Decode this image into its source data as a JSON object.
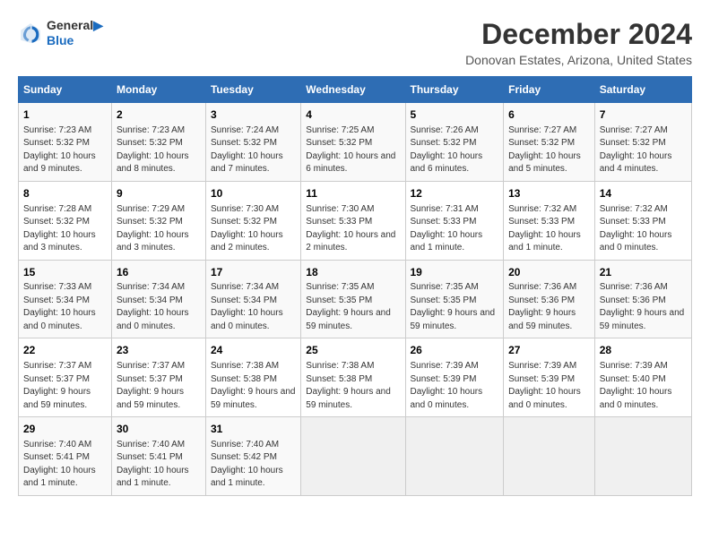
{
  "header": {
    "logo_line1": "General",
    "logo_line2": "Blue",
    "title": "December 2024",
    "subtitle": "Donovan Estates, Arizona, United States"
  },
  "columns": [
    "Sunday",
    "Monday",
    "Tuesday",
    "Wednesday",
    "Thursday",
    "Friday",
    "Saturday"
  ],
  "weeks": [
    [
      {
        "day": "1",
        "text": "Sunrise: 7:23 AM\nSunset: 5:32 PM\nDaylight: 10 hours and 9 minutes."
      },
      {
        "day": "2",
        "text": "Sunrise: 7:23 AM\nSunset: 5:32 PM\nDaylight: 10 hours and 8 minutes."
      },
      {
        "day": "3",
        "text": "Sunrise: 7:24 AM\nSunset: 5:32 PM\nDaylight: 10 hours and 7 minutes."
      },
      {
        "day": "4",
        "text": "Sunrise: 7:25 AM\nSunset: 5:32 PM\nDaylight: 10 hours and 6 minutes."
      },
      {
        "day": "5",
        "text": "Sunrise: 7:26 AM\nSunset: 5:32 PM\nDaylight: 10 hours and 6 minutes."
      },
      {
        "day": "6",
        "text": "Sunrise: 7:27 AM\nSunset: 5:32 PM\nDaylight: 10 hours and 5 minutes."
      },
      {
        "day": "7",
        "text": "Sunrise: 7:27 AM\nSunset: 5:32 PM\nDaylight: 10 hours and 4 minutes."
      }
    ],
    [
      {
        "day": "8",
        "text": "Sunrise: 7:28 AM\nSunset: 5:32 PM\nDaylight: 10 hours and 3 minutes."
      },
      {
        "day": "9",
        "text": "Sunrise: 7:29 AM\nSunset: 5:32 PM\nDaylight: 10 hours and 3 minutes."
      },
      {
        "day": "10",
        "text": "Sunrise: 7:30 AM\nSunset: 5:32 PM\nDaylight: 10 hours and 2 minutes."
      },
      {
        "day": "11",
        "text": "Sunrise: 7:30 AM\nSunset: 5:33 PM\nDaylight: 10 hours and 2 minutes."
      },
      {
        "day": "12",
        "text": "Sunrise: 7:31 AM\nSunset: 5:33 PM\nDaylight: 10 hours and 1 minute."
      },
      {
        "day": "13",
        "text": "Sunrise: 7:32 AM\nSunset: 5:33 PM\nDaylight: 10 hours and 1 minute."
      },
      {
        "day": "14",
        "text": "Sunrise: 7:32 AM\nSunset: 5:33 PM\nDaylight: 10 hours and 0 minutes."
      }
    ],
    [
      {
        "day": "15",
        "text": "Sunrise: 7:33 AM\nSunset: 5:34 PM\nDaylight: 10 hours and 0 minutes."
      },
      {
        "day": "16",
        "text": "Sunrise: 7:34 AM\nSunset: 5:34 PM\nDaylight: 10 hours and 0 minutes."
      },
      {
        "day": "17",
        "text": "Sunrise: 7:34 AM\nSunset: 5:34 PM\nDaylight: 10 hours and 0 minutes."
      },
      {
        "day": "18",
        "text": "Sunrise: 7:35 AM\nSunset: 5:35 PM\nDaylight: 9 hours and 59 minutes."
      },
      {
        "day": "19",
        "text": "Sunrise: 7:35 AM\nSunset: 5:35 PM\nDaylight: 9 hours and 59 minutes."
      },
      {
        "day": "20",
        "text": "Sunrise: 7:36 AM\nSunset: 5:36 PM\nDaylight: 9 hours and 59 minutes."
      },
      {
        "day": "21",
        "text": "Sunrise: 7:36 AM\nSunset: 5:36 PM\nDaylight: 9 hours and 59 minutes."
      }
    ],
    [
      {
        "day": "22",
        "text": "Sunrise: 7:37 AM\nSunset: 5:37 PM\nDaylight: 9 hours and 59 minutes."
      },
      {
        "day": "23",
        "text": "Sunrise: 7:37 AM\nSunset: 5:37 PM\nDaylight: 9 hours and 59 minutes."
      },
      {
        "day": "24",
        "text": "Sunrise: 7:38 AM\nSunset: 5:38 PM\nDaylight: 9 hours and 59 minutes."
      },
      {
        "day": "25",
        "text": "Sunrise: 7:38 AM\nSunset: 5:38 PM\nDaylight: 9 hours and 59 minutes."
      },
      {
        "day": "26",
        "text": "Sunrise: 7:39 AM\nSunset: 5:39 PM\nDaylight: 10 hours and 0 minutes."
      },
      {
        "day": "27",
        "text": "Sunrise: 7:39 AM\nSunset: 5:39 PM\nDaylight: 10 hours and 0 minutes."
      },
      {
        "day": "28",
        "text": "Sunrise: 7:39 AM\nSunset: 5:40 PM\nDaylight: 10 hours and 0 minutes."
      }
    ],
    [
      {
        "day": "29",
        "text": "Sunrise: 7:40 AM\nSunset: 5:41 PM\nDaylight: 10 hours and 1 minute."
      },
      {
        "day": "30",
        "text": "Sunrise: 7:40 AM\nSunset: 5:41 PM\nDaylight: 10 hours and 1 minute."
      },
      {
        "day": "31",
        "text": "Sunrise: 7:40 AM\nSunset: 5:42 PM\nDaylight: 10 hours and 1 minute."
      },
      {
        "day": "",
        "text": ""
      },
      {
        "day": "",
        "text": ""
      },
      {
        "day": "",
        "text": ""
      },
      {
        "day": "",
        "text": ""
      }
    ]
  ]
}
